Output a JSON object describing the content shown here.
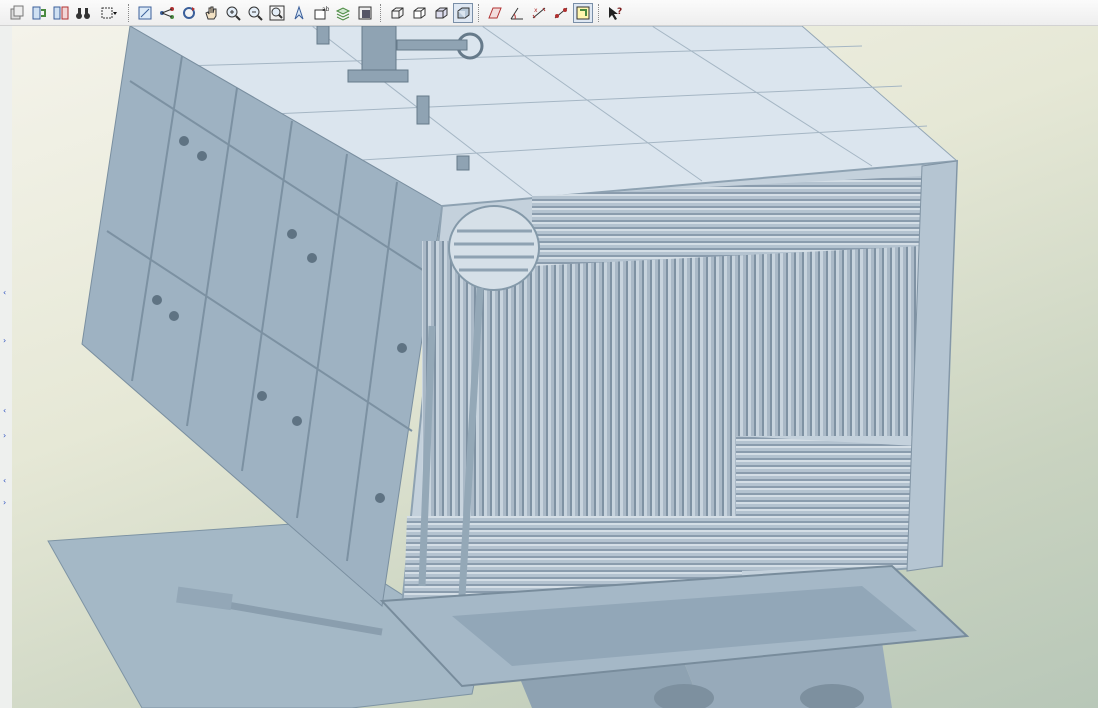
{
  "app": {
    "view": "3D model viewport",
    "background_colors": [
      "#f4f3ea",
      "#c9d3c0"
    ],
    "model_color": "#a9bccb",
    "selection_frame_color": "#7a8fa8"
  },
  "toolbar": {
    "groups": [
      {
        "name": "file",
        "items": [
          {
            "icon": "copy-icon"
          },
          {
            "icon": "sync-icon"
          },
          {
            "icon": "compare-icon"
          },
          {
            "icon": "binoculars-icon"
          },
          {
            "icon": "select-box-dropdown-icon"
          }
        ]
      },
      {
        "name": "view-navigation",
        "items": [
          {
            "icon": "view-frame-icon"
          },
          {
            "icon": "connect-icon"
          },
          {
            "icon": "rotate-icon"
          },
          {
            "icon": "pan-hand-icon"
          },
          {
            "icon": "zoom-in-icon"
          },
          {
            "icon": "zoom-out-icon"
          },
          {
            "icon": "zoom-fit-icon"
          },
          {
            "icon": "fly-through-icon"
          },
          {
            "icon": "named-view-icon"
          },
          {
            "icon": "layers-icon"
          },
          {
            "icon": "render-settings-icon"
          }
        ]
      },
      {
        "name": "display-mode",
        "items": [
          {
            "icon": "wireframe-icon"
          },
          {
            "icon": "hidden-line-icon"
          },
          {
            "icon": "shaded-edges-icon"
          },
          {
            "icon": "shaded-icon",
            "active": true
          }
        ]
      },
      {
        "name": "measure",
        "items": [
          {
            "icon": "section-plane-icon"
          },
          {
            "icon": "measure-angle-icon"
          },
          {
            "icon": "measure-distance-icon"
          },
          {
            "icon": "measure-points-icon"
          },
          {
            "icon": "clipping-box-icon",
            "active": true
          }
        ]
      },
      {
        "name": "help",
        "items": [
          {
            "icon": "whats-this-help-icon"
          }
        ]
      }
    ]
  },
  "left_strip": {
    "markers": [
      "‹",
      "›",
      "‹",
      "›",
      "‹",
      "›"
    ]
  }
}
